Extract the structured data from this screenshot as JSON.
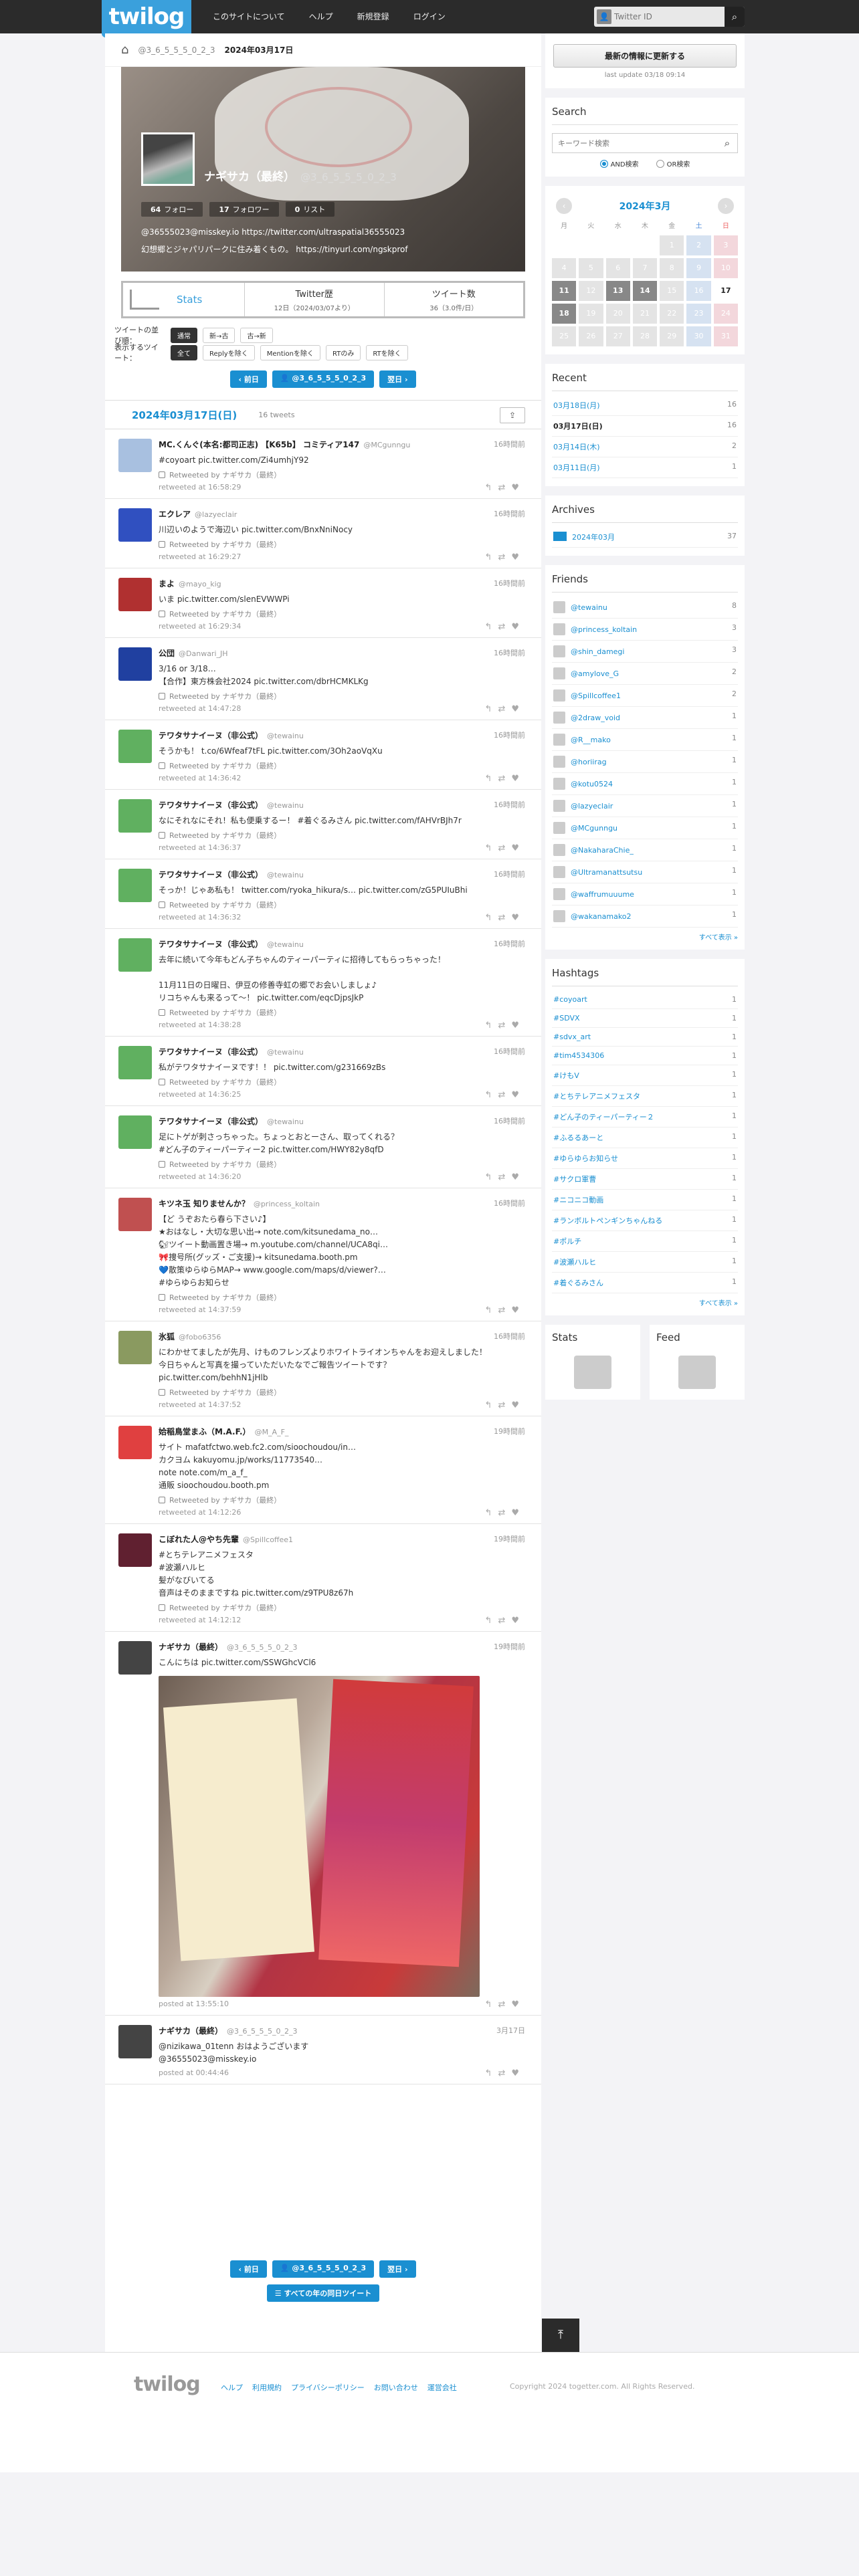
{
  "header": {
    "logo": "twilog",
    "nav": [
      "このサイトについて",
      "ヘルプ",
      "新規登録",
      "ログイン"
    ],
    "search_placeholder": "Twitter ID"
  },
  "breadcrumb": {
    "user": "@3_6_5_5_5_0_2_3",
    "date": "2024年03月17日"
  },
  "profile": {
    "name": "ナギサカ（最終）",
    "screen_name": "@3_6_5_5_5_0_2_3",
    "follows": "64",
    "follow_label": "フォロー",
    "followers": "17",
    "follower_label": "フォロワー",
    "lists": "0",
    "list_label": "リスト",
    "line1": "@36555023@misskey.io  https://twitter.com/ultraspatial36555023",
    "line2": "幻想郷とジャパリパークに住み着くもの。 https://tinyurl.com/ngskprof"
  },
  "stats": {
    "label": "Stats",
    "twitter_start_label": "Twitter歴",
    "twitter_start": "12日（2024/03/07より）",
    "tweet_count_label": "ツイート数",
    "tweet_count": "36（3.0件/日）"
  },
  "filters": {
    "order_label": "ツイートの並び順：",
    "order": [
      "通常",
      "新→古",
      "古→新"
    ],
    "show_label": "表示するツイート：",
    "show": [
      "全て",
      "Replyを除く",
      "Mentionを除く",
      "RTのみ",
      "RTを除く"
    ]
  },
  "pager": {
    "prev": "前日",
    "user": "@3_6_5_5_5_0_2_3",
    "next": "翌日",
    "all": "すべての年の同日ツイート"
  },
  "day": {
    "title": "2024年03月17日(日)",
    "count": "16 tweets"
  },
  "tweets": [
    {
      "name": "MC.くんぐ(本名:都司正志) 【K65b】 コミティア147",
      "sn": "@MCgunngu",
      "time": "16時間前",
      "body": "#coyoart pic.twitter.com/Zi4umhjY92",
      "rt": "Retweeted by ナギサカ（最終）",
      "at": "retweeted at 16:58:29",
      "color": "#a8c0e0"
    },
    {
      "name": "エクレア",
      "sn": "@lazyeclair",
      "time": "16時間前",
      "body": "川辺いのようで海辺い pic.twitter.com/BnxNniNocy",
      "rt": "Retweeted by ナギサカ（最終）",
      "at": "retweeted at 16:29:27",
      "color": "#3050c0"
    },
    {
      "name": "まよ",
      "sn": "@mayo_kig",
      "time": "16時間前",
      "body": "いま pic.twitter.com/slenEVWWPi",
      "rt": "Retweeted by ナギサカ（最終）",
      "at": "retweeted at 16:29:34",
      "color": "#b03030"
    },
    {
      "name": "公団",
      "sn": "@Danwari_JH",
      "time": "16時間前",
      "body": "3/16 or 3/18…\n【合作】東方株会社2024 pic.twitter.com/dbrHCMKLKg",
      "rt": "Retweeted by ナギサカ（最終）",
      "at": "retweeted at 14:47:28",
      "color": "#2040a0"
    },
    {
      "name": "テワタサナイーヌ（非公式）",
      "sn": "@tewainu",
      "time": "16時間前",
      "body": "そうかも！ t.co/6Wfeaf7tFL pic.twitter.com/3Oh2aoVqXu",
      "rt": "Retweeted by ナギサカ（最終）",
      "at": "retweeted at 14:36:42",
      "color": "#60b060"
    },
    {
      "name": "テワタサナイーヌ（非公式）",
      "sn": "@tewainu",
      "time": "16時間前",
      "body": "なにそれなにそれ！私も便乗するー！ #着ぐるみさん pic.twitter.com/fAHVrBJh7r",
      "rt": "Retweeted by ナギサカ（最終）",
      "at": "retweeted at 14:36:37",
      "color": "#60b060"
    },
    {
      "name": "テワタサナイーヌ（非公式）",
      "sn": "@tewainu",
      "time": "16時間前",
      "body": "そっか！じゃあ私も！ twitter.com/ryoka_hikura/s… pic.twitter.com/zG5PUIuBhi",
      "rt": "Retweeted by ナギサカ（最終）",
      "at": "retweeted at 14:36:32",
      "color": "#60b060"
    },
    {
      "name": "テワタサナイーヌ（非公式）",
      "sn": "@tewainu",
      "time": "16時間前",
      "body": "去年に続いて今年もどん子ちゃんのティーパーティに招待してもらっちゃった！\n\n11月11日の日曜日、伊豆の修善寺虹の郷でお会いしましょ♪\nリコちゃんも来るって～！ pic.twitter.com/eqcDjpsJkP",
      "rt": "Retweeted by ナギサカ（最終）",
      "at": "retweeted at 14:38:28",
      "color": "#60b060"
    },
    {
      "name": "テワタサナイーヌ（非公式）",
      "sn": "@tewainu",
      "time": "16時間前",
      "body": "私がテワタサナイーヌです！！ pic.twitter.com/g231669zBs",
      "rt": "Retweeted by ナギサカ（最終）",
      "at": "retweeted at 14:36:25",
      "color": "#60b060"
    },
    {
      "name": "テワタサナイーヌ（非公式）",
      "sn": "@tewainu",
      "time": "16時間前",
      "body": "足にトゲが刺さっちゃった。ちょっとおとーさん、取ってくれる？\n#どん子のティーパーティー2 pic.twitter.com/HWY82y8qfD",
      "rt": "Retweeted by ナギサカ（最終）",
      "at": "retweeted at 14:36:20",
      "color": "#60b060"
    },
    {
      "name": "キツネ玉 知りませんか？",
      "sn": "@princess_koltain",
      "time": "16時間前",
      "body": "【ど うぞおたら春ら下さい♪】\n★おはなし・大切な思い出→ note.com/kitsunedama_no…\n🐿ツイート動画置き場→ m.youtube.com/channel/UCA8qi…\n🎀捜号所(グッズ・ご支援)→ kitsunedama.booth.pm\n💙散策ゆらゆらMAP→ www.google.com/maps/d/viewer?…\n#ゆらゆらお知らせ",
      "rt": "Retweeted by ナギサカ（最終）",
      "at": "retweeted at 14:37:59",
      "color": "#c05050"
    },
    {
      "name": "氷狐",
      "sn": "@fobo6356",
      "time": "16時間前",
      "body": "にわかせてましたが先月、けものフレンズよりホワイトライオンちゃんをお迎えしました！\n今日ちゃんと写真を撮っていただいたなでご報告ツイートです？\npic.twitter.com/behhN1jHlb",
      "rt": "Retweeted by ナギサカ（最終）",
      "at": "retweeted at 14:37:52",
      "color": "#8a9a60"
    },
    {
      "name": "姶稲鳥堂まふ（M.A.F.）",
      "sn": "@M_A_F_",
      "time": "19時間前",
      "body": "サイト mafatfctwo.web.fc2.com/sioochoudou/in…\nカクヨム kakuyomu.jp/works/11773540…\nnote note.com/m_a_f_\n通販 sioochoudou.booth.pm",
      "rt": "Retweeted by ナギサカ（最終）",
      "at": "retweeted at 14:12:26",
      "color": "#e04040"
    },
    {
      "name": "こぼれた人@やち先輩",
      "sn": "@Spillcoffee1",
      "time": "19時間前",
      "body": "#とちテレアニメフェスタ\n#波瀬ハルヒ\n髪がなびいてる\n音声はそのままですね pic.twitter.com/z9TPU8z67h",
      "rt": "Retweeted by ナギサカ（最終）",
      "at": "retweeted at 14:12:12",
      "color": "#602030"
    },
    {
      "name": "ナギサカ（最終）",
      "sn": "@3_6_5_5_5_0_2_3",
      "time": "19時間前",
      "body": "こんにちは pic.twitter.com/SSWGhcVCl6",
      "rt": "",
      "at": "posted at 13:55:10",
      "color": "#444"
    },
    {
      "name": "ナギサカ（最終）",
      "sn": "@3_6_5_5_5_0_2_3",
      "time": "3月17日",
      "body": "@nizikawa_01tenn おはようございます\n@36555023@misskey.io",
      "rt": "",
      "at": "posted at 00:44:46",
      "color": "#444"
    }
  ],
  "sidebar": {
    "update_btn": "最新の情報に更新する",
    "last_update": "last update 03/18 09:14",
    "search_title": "Search",
    "search_placeholder": "キーワード検索",
    "and": "AND検索",
    "or": "OR検索",
    "cal_title": "2024年3月",
    "weekdays": [
      "月",
      "火",
      "水",
      "木",
      "金",
      "土",
      "日"
    ],
    "recent_title": "Recent",
    "recent": [
      {
        "d": "03月18日(月)",
        "c": "16"
      },
      {
        "d": "03月17日(日)",
        "c": "16"
      },
      {
        "d": "03月14日(木)",
        "c": "2"
      },
      {
        "d": "03月11日(月)",
        "c": "1"
      }
    ],
    "archives_title": "Archives",
    "archives": [
      {
        "d": "2024年03月",
        "c": "37"
      }
    ],
    "friends_title": "Friends",
    "friends": [
      {
        "n": "@tewainu",
        "c": "8"
      },
      {
        "n": "@princess_koltain",
        "c": "3"
      },
      {
        "n": "@shin_damegi",
        "c": "3"
      },
      {
        "n": "@amylove_G",
        "c": "2"
      },
      {
        "n": "@Spillcoffee1",
        "c": "2"
      },
      {
        "n": "@2draw_void",
        "c": "1"
      },
      {
        "n": "@R__mako",
        "c": "1"
      },
      {
        "n": "@horiirag",
        "c": "1"
      },
      {
        "n": "@kotu0524",
        "c": "1"
      },
      {
        "n": "@lazyeclair",
        "c": "1"
      },
      {
        "n": "@MCgunngu",
        "c": "1"
      },
      {
        "n": "@NakaharaChie_",
        "c": "1"
      },
      {
        "n": "@Ultramanattsutsu",
        "c": "1"
      },
      {
        "n": "@waffrumuuume",
        "c": "1"
      },
      {
        "n": "@wakanamako2",
        "c": "1"
      }
    ],
    "more": "すべて表示 »",
    "hashtags_title": "Hashtags",
    "hashtags": [
      {
        "n": "#coyoart",
        "c": "1"
      },
      {
        "n": "#SDVX",
        "c": "1"
      },
      {
        "n": "#sdvx_art",
        "c": "1"
      },
      {
        "n": "#tim4534306",
        "c": "1"
      },
      {
        "n": "#けもV",
        "c": "1"
      },
      {
        "n": "#とちテレアニメフェスタ",
        "c": "1"
      },
      {
        "n": "#どん子のティーパーティー２",
        "c": "1"
      },
      {
        "n": "#ふるるあーと",
        "c": "1"
      },
      {
        "n": "#ゆらゆらお知らせ",
        "c": "1"
      },
      {
        "n": "#サクロ軍曹",
        "c": "1"
      },
      {
        "n": "#ニコニコ動画",
        "c": "1"
      },
      {
        "n": "#ランボルトペンギンちゃんねる",
        "c": "1"
      },
      {
        "n": "#ポルチ",
        "c": "1"
      },
      {
        "n": "#波瀬ハルヒ",
        "c": "1"
      },
      {
        "n": "#着ぐるみさん",
        "c": "1"
      }
    ],
    "stats_title": "Stats",
    "feed_title": "Feed"
  },
  "footer": {
    "logo": "twilog",
    "links": [
      "ヘルプ",
      "利用規約",
      "プライバシーポリシー",
      "お問い合わせ",
      "運営会社"
    ],
    "copy": "Copyright 2024 togetter.com. All Rights Reserved."
  }
}
